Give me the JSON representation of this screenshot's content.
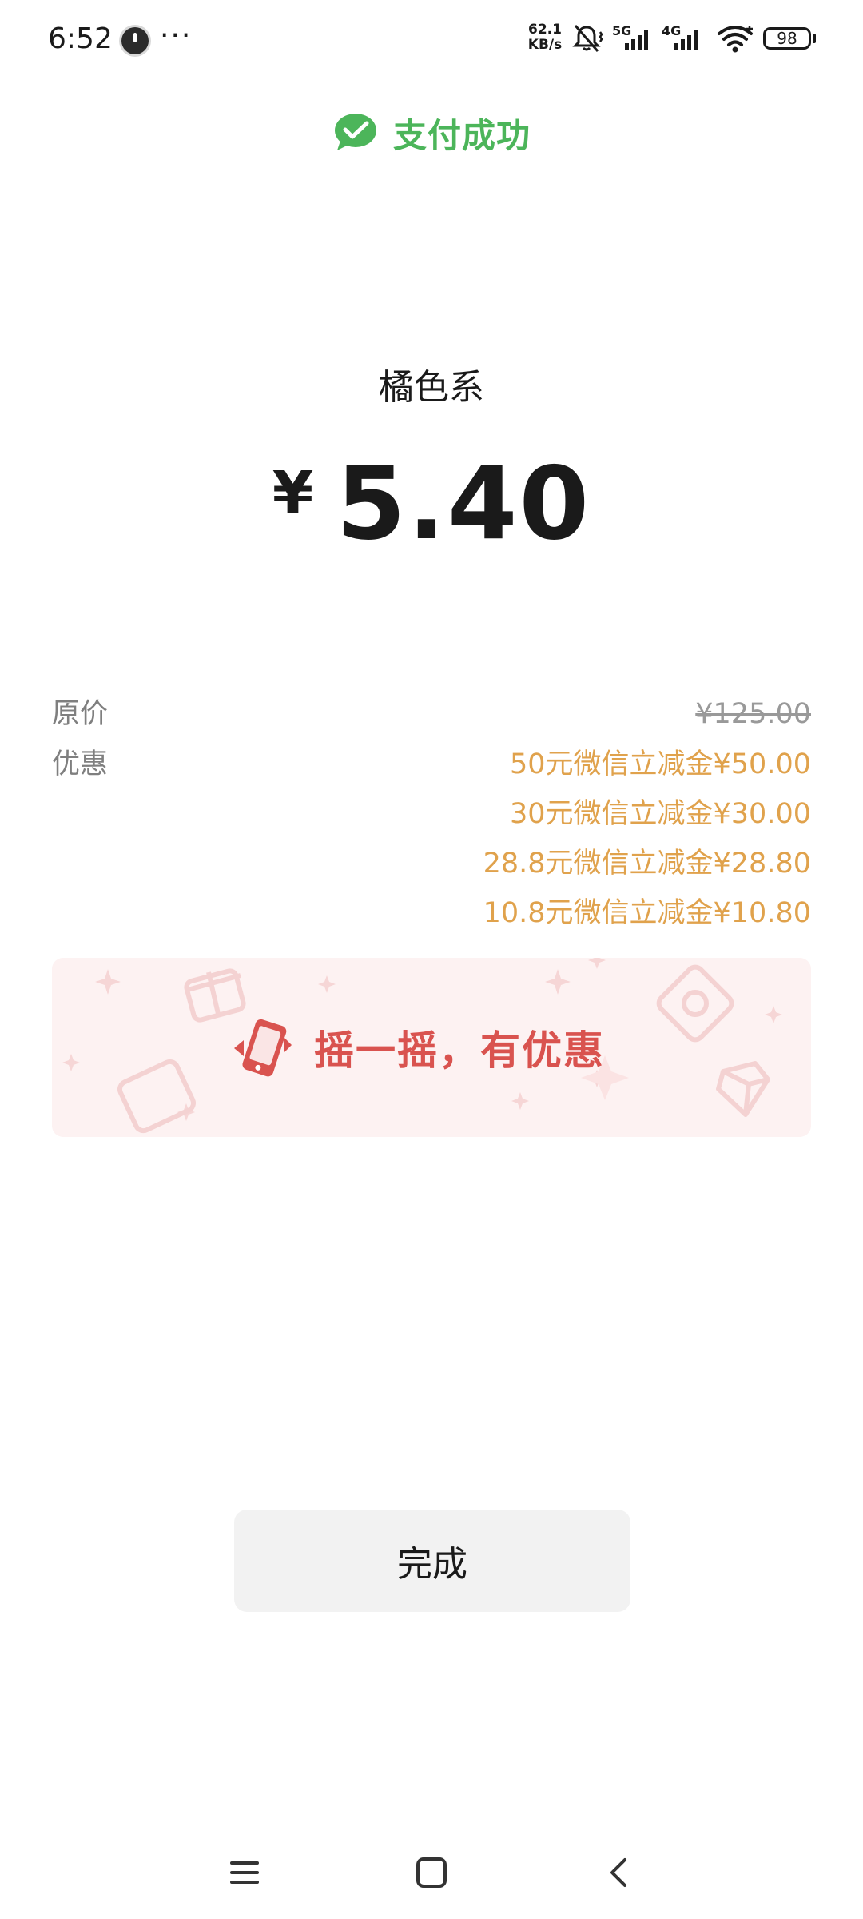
{
  "status_bar": {
    "time": "6:52",
    "more": "···",
    "net_speed_value": "62.1",
    "net_speed_unit": "KB/s",
    "network_5g": "5G",
    "network_4g": "4G",
    "battery": "98",
    "icons": [
      "app-notification-icon",
      "silent-mode-icon",
      "signal-5g-icon",
      "signal-4g-icon",
      "wifi-icon",
      "battery-icon"
    ]
  },
  "header": {
    "title": "支付成功",
    "icon": "wechat-pay-check-icon",
    "color": "#4cb55a"
  },
  "payment": {
    "merchant": "橘色系",
    "currency": "¥",
    "amount": "5.40"
  },
  "details": {
    "original_label": "原价",
    "original_value": "¥125.00",
    "discount_label": "优惠",
    "discounts": [
      "50元微信立减金¥50.00",
      "30元微信立减金¥30.00",
      "28.8元微信立减金¥28.80",
      "10.8元微信立减金¥10.80"
    ],
    "discount_color": "#e0a24c"
  },
  "banner": {
    "text": "摇一摇，有优惠",
    "icon": "shake-phone-icon",
    "color": "#d9534f"
  },
  "actions": {
    "done_label": "完成"
  },
  "nav": {
    "icons": [
      "menu-icon",
      "home-icon",
      "back-icon"
    ]
  }
}
